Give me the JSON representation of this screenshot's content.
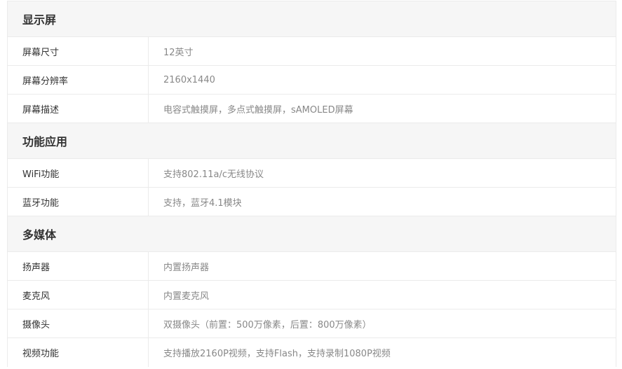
{
  "sections": [
    {
      "title": "显示屏",
      "rows": [
        {
          "label": "屏幕尺寸",
          "value": "12英寸"
        },
        {
          "label": "屏幕分辨率",
          "value": "2160x1440"
        },
        {
          "label": "屏幕描述",
          "value": "电容式触摸屏，多点式触摸屏，sAMOLED屏幕"
        }
      ]
    },
    {
      "title": "功能应用",
      "rows": [
        {
          "label": "WiFi功能",
          "value": "支持802.11a/c无线协议"
        },
        {
          "label": "蓝牙功能",
          "value": "支持，蓝牙4.1模块"
        }
      ]
    },
    {
      "title": "多媒体",
      "rows": [
        {
          "label": "扬声器",
          "value": "内置扬声器"
        },
        {
          "label": "麦克风",
          "value": "内置麦克风"
        },
        {
          "label": "摄像头",
          "value": "双摄像头（前置：500万像素，后置：800万像素）"
        },
        {
          "label": "视频功能",
          "value": "支持播放2160P视频，支持Flash，支持录制1080P视频"
        }
      ]
    }
  ],
  "colors": {
    "header_bg": "#f6f6f6",
    "border": "#ebebeb",
    "label_text": "#333333",
    "value_text": "#888888"
  }
}
